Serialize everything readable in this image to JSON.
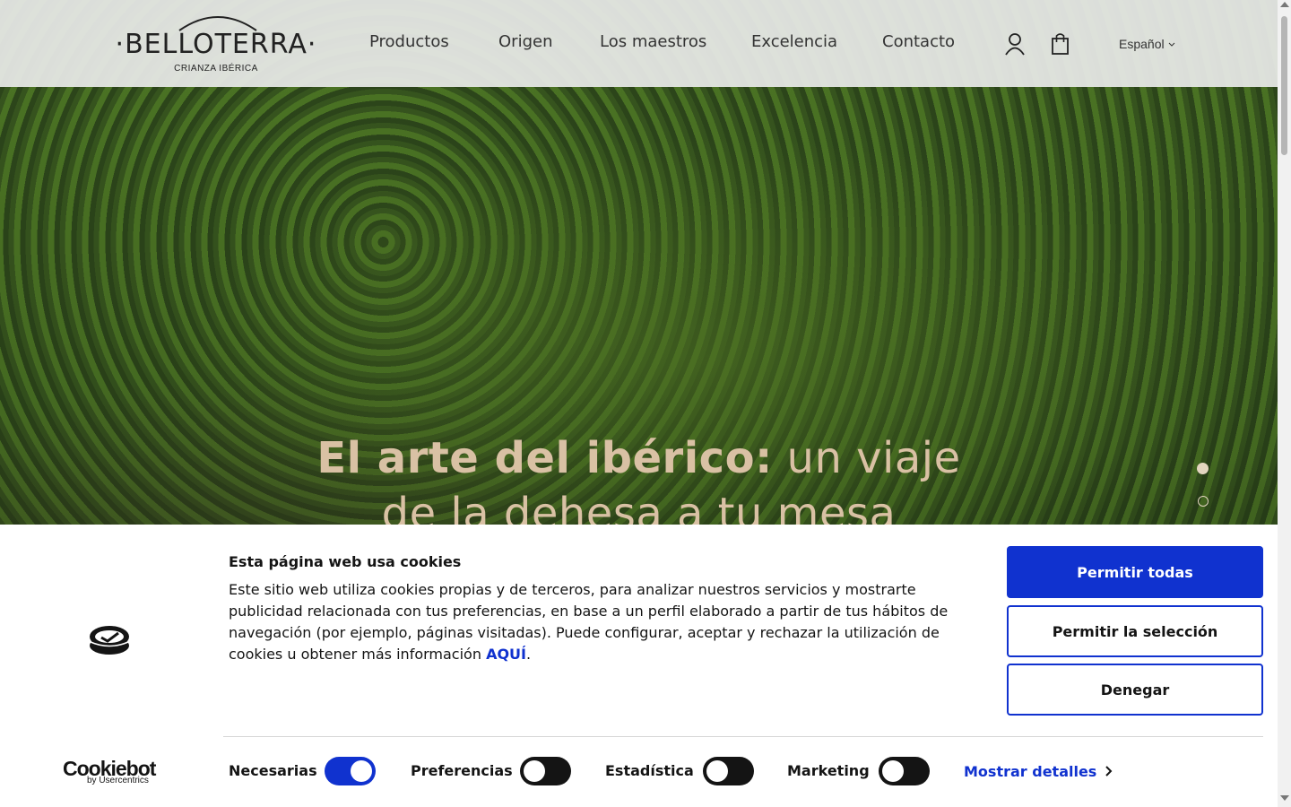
{
  "header": {
    "logo": {
      "name": "BELLOTERRA",
      "tagline": "CRIANZA IBÉRICA"
    },
    "nav": [
      {
        "label": "Productos"
      },
      {
        "label": "Origen"
      },
      {
        "label": "Los maestros"
      },
      {
        "label": "Excelencia"
      },
      {
        "label": "Contacto"
      }
    ],
    "icons": {
      "account": "user-icon",
      "cart": "shopping-bag-icon"
    },
    "language": "Español"
  },
  "hero": {
    "title_strong": "El arte del ibérico:",
    "title_rest": "un viaje de la dehesa a tu mesa",
    "slides": {
      "count": 2,
      "active": 1
    }
  },
  "cookie_banner": {
    "title": "Esta página web usa cookies",
    "text": "Este sitio web utiliza cookies propias y de terceros, para analizar nuestros servicios y mostrarte publicidad relacionada con tus preferencias, en base a un perfil elaborado a partir de tus hábitos de navegación (por ejemplo, páginas visitadas). Puede configurar, aceptar y rechazar la utilización de cookies u obtener más información",
    "link": "AQUÍ",
    "buttons": {
      "allow_all": "Permitir todas",
      "allow_selection": "Permitir la selección",
      "deny": "Denegar"
    },
    "brand": {
      "name": "Cookiebot",
      "sub": "by Usercentrics"
    },
    "toggles": [
      {
        "label": "Necesarias",
        "on": true
      },
      {
        "label": "Preferencias",
        "on": false
      },
      {
        "label": "Estadística",
        "on": false
      },
      {
        "label": "Marketing",
        "on": false
      }
    ],
    "show_details": "Mostrar detalles"
  },
  "colors": {
    "accent": "#1032cf",
    "hero_text": "#d9c1a4",
    "dark": "#141414"
  }
}
